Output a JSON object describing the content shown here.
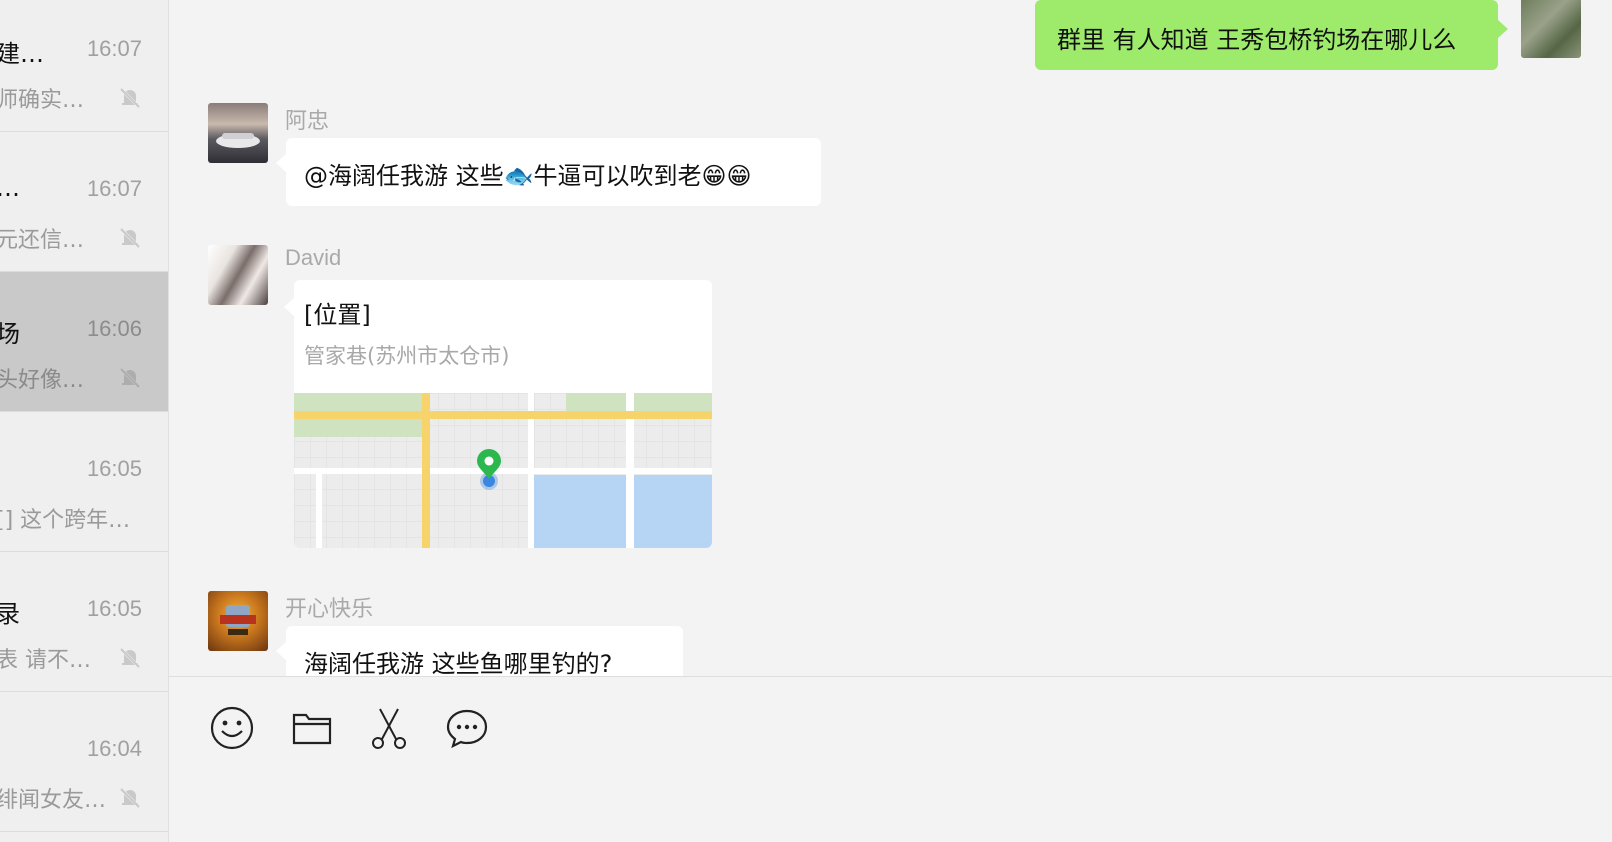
{
  "sidebar": {
    "items": [
      {
        "name": "建…",
        "time": "16:07",
        "preview": "师确实…",
        "muted": true,
        "selected": false
      },
      {
        "name": "…",
        "time": "16:07",
        "preview": "元还信…",
        "muted": true,
        "selected": false
      },
      {
        "name": "场",
        "time": "16:06",
        "preview": "头好像…",
        "muted": true,
        "selected": true
      },
      {
        "name": "",
        "time": "16:05",
        "preview": "[] 这个跨年…",
        "muted": false,
        "selected": false
      },
      {
        "name": "录",
        "time": "16:05",
        "preview": "表 请不…",
        "muted": true,
        "selected": false
      },
      {
        "name": "",
        "time": "16:04",
        "preview": "绯闻女友…",
        "muted": true,
        "selected": false
      }
    ]
  },
  "messages": [
    {
      "type": "text",
      "mine": true,
      "text": "群里 有人知道 王秀包桥钓场在哪儿么"
    },
    {
      "type": "text",
      "mine": false,
      "sender": "阿忠",
      "text": "@海阔任我游 这些🐟牛逼可以吹到老😁😁"
    },
    {
      "type": "location",
      "mine": false,
      "sender": "David",
      "title": "[位置]",
      "address": "管家巷(苏州市太仓市)"
    },
    {
      "type": "text",
      "mine": false,
      "sender": "开心快乐",
      "text": "海阔任我游 这些鱼哪里钓的?"
    }
  ],
  "toolbar": {
    "icons": [
      "emoji-icon",
      "folder-icon",
      "scissors-icon",
      "chat-bubble-icon"
    ]
  },
  "colors": {
    "my_bubble": "#9eea6a",
    "selected_item": "#c9c9c9",
    "map_road": "#f7d46b",
    "map_water": "#b6d5f5",
    "map_green": "#cfe3c0",
    "pin_green": "#2db84d",
    "pin_blue": "#3a86e0"
  }
}
